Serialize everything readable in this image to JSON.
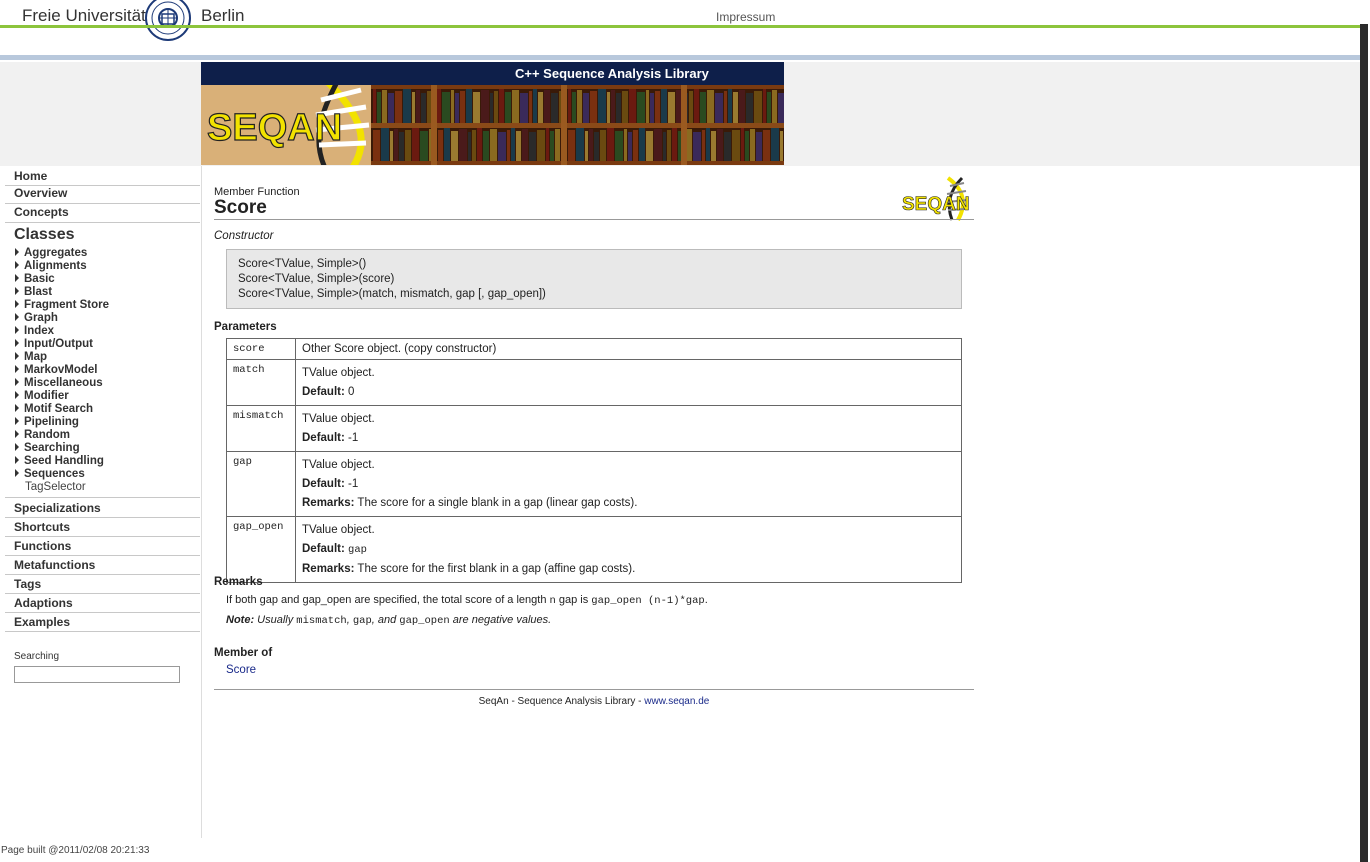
{
  "top": {
    "logo_left": "Freie Universität",
    "logo_right": "Berlin",
    "impressum": "Impressum"
  },
  "banner": {
    "title": "C++ Sequence Analysis Library",
    "logo_text": "SEQAN"
  },
  "sidebar": {
    "home": "Home",
    "overview": "Overview",
    "concepts": "Concepts",
    "classes_heading": "Classes",
    "classes": [
      "Aggregates",
      "Alignments",
      "Basic",
      "Blast",
      "Fragment Store",
      "Graph",
      "Index",
      "Input/Output",
      "Map",
      "MarkovModel",
      "Miscellaneous",
      "Modifier",
      "Motif Search",
      "Pipelining",
      "Random",
      "Searching",
      "Seed Handling",
      "Sequences"
    ],
    "tag_selector": "TagSelector",
    "bottom": [
      "Specializations",
      "Shortcuts",
      "Functions",
      "Metafunctions",
      "Tags",
      "Adaptions",
      "Examples"
    ],
    "search_label": "Searching",
    "search_value": ""
  },
  "content": {
    "kind": "Member Function",
    "name": "Score",
    "constructor_label": "Constructor",
    "signatures": [
      "Score<TValue, Simple>()",
      "Score<TValue, Simple>(score)",
      "Score<TValue, Simple>(match, mismatch, gap [, gap_open])"
    ],
    "params_heading": "Parameters",
    "params": {
      "score": {
        "name": "score",
        "desc": "Other Score object. (copy constructor)"
      },
      "match": {
        "name": "match",
        "desc": "TValue object.",
        "default_label": "Default:",
        "default": "0"
      },
      "mismatch": {
        "name": "mismatch",
        "desc": "TValue object.",
        "default_label": "Default:",
        "default": "-1"
      },
      "gap": {
        "name": "gap",
        "desc": "TValue object.",
        "default_label": "Default:",
        "default": "-1",
        "remarks_label": "Remarks:",
        "remarks": "The score for a single blank in a gap (linear gap costs)."
      },
      "gap_open": {
        "name": "gap_open",
        "desc": "TValue object.",
        "default_label": "Default:",
        "default": "gap",
        "remarks_label": "Remarks:",
        "remarks": "The score for the first blank in a gap (affine gap costs)."
      }
    },
    "remarks_heading": "Remarks",
    "remarks": {
      "t1": "If both gap and gap_open are specified, the total score of a length ",
      "c1": "n",
      "t2": " gap is ",
      "c2": "gap_open (n-1)*gap",
      "t3": "."
    },
    "note": {
      "label": "Note:",
      "t1": " Usually ",
      "c1": "mismatch",
      "t2": ", ",
      "c2": "gap",
      "t3": ", and ",
      "c3": "gap_open",
      "t4": " are negative values."
    },
    "member_of_heading": "Member of",
    "member_of_link": "Score",
    "footer_text": "SeqAn - Sequence Analysis Library - ",
    "footer_link": "www.seqan.de"
  },
  "page_built": "Page built @2011/02/08 20:21:33",
  "colors": {
    "green_line": "#8cc43c",
    "blue_line": "#b8c8dc",
    "banner_bar": "#0e1f4a",
    "logo_yellow": "#f2e200",
    "link": "#1a2a8a"
  }
}
